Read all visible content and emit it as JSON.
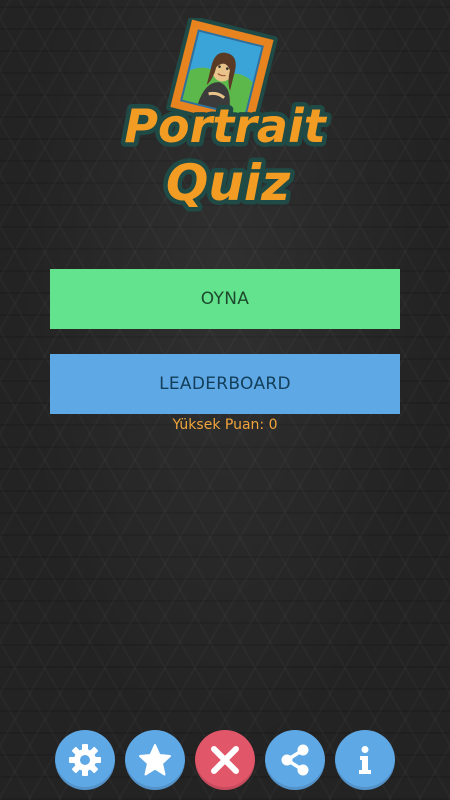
{
  "logo": {
    "line1": "Portrait",
    "line2": "Quiz"
  },
  "menu": {
    "play_label": "OYNA",
    "leaderboard_label": "LEADERBOARD"
  },
  "high_score": {
    "label": "Yüksek Puan:",
    "value": "0"
  },
  "bottom_bar": {
    "buttons": [
      {
        "name": "settings",
        "icon": "gear-icon"
      },
      {
        "name": "rate",
        "icon": "star-icon"
      },
      {
        "name": "close",
        "icon": "close-icon"
      },
      {
        "name": "share",
        "icon": "share-icon"
      },
      {
        "name": "info",
        "icon": "info-icon"
      }
    ]
  },
  "colors": {
    "background": "#232323",
    "play_button": "#63e38e",
    "leaderboard_button": "#5fa8e6",
    "high_score_text": "#f0a43a",
    "round_button": "#5fa8e6",
    "close_button": "#e2566a",
    "logo_orange": "#f39c23",
    "logo_outline": "#1f4a45",
    "frame_orange": "#e8841f"
  }
}
